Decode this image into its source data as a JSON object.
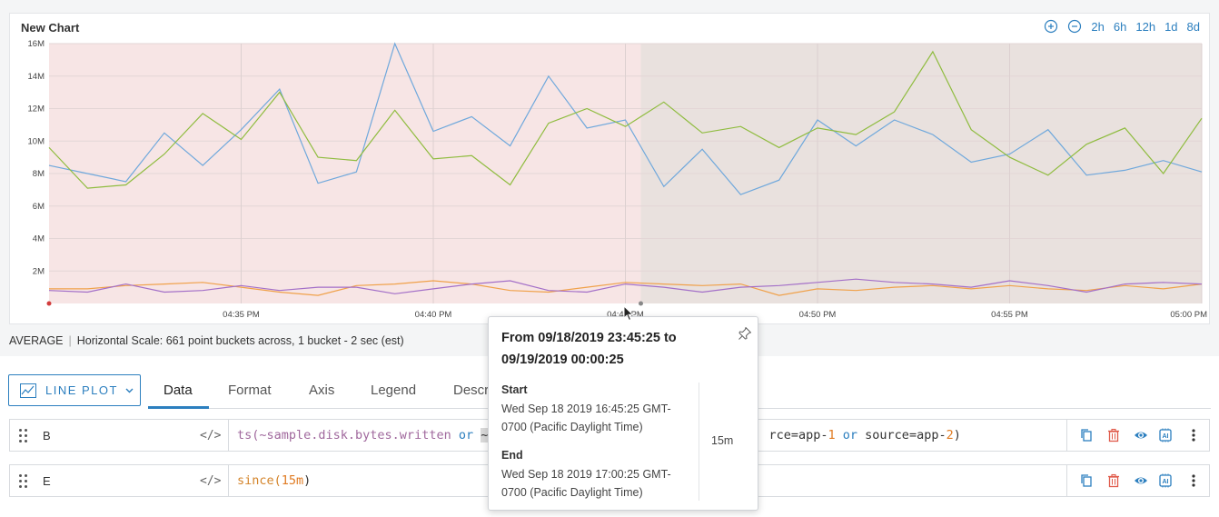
{
  "chart": {
    "title": "New Chart",
    "range_buttons": [
      "2h",
      "6h",
      "12h",
      "1d",
      "8d"
    ],
    "zoom_in_icon": "zoom-in-icon",
    "zoom_out_icon": "zoom-out-icon"
  },
  "chart_data": {
    "type": "line",
    "x_tick_labels": [
      "04:35 PM",
      "04:40 PM",
      "04:45 PM",
      "04:50 PM",
      "04:55 PM",
      "05:00 PM"
    ],
    "y_tick_labels": [
      "2M",
      "4M",
      "6M",
      "8M",
      "10M",
      "12M",
      "14M",
      "16M"
    ],
    "ylim": [
      0,
      16
    ],
    "grid": true,
    "highlight_band": {
      "from": "04:30 PM",
      "to": "05:00 PM",
      "color": "#f7e5e5"
    },
    "selected_band": {
      "from": "04:45 PM",
      "to": "05:00 PM",
      "color": "#e9e1de"
    },
    "series": [
      {
        "color": "#6fa8dc",
        "values": [
          8.5,
          8.0,
          7.5,
          10.5,
          8.5,
          10.7,
          13.2,
          7.4,
          8.1,
          16.0,
          10.6,
          11.5,
          9.7,
          14.0,
          10.8,
          11.3,
          7.2,
          9.5,
          6.7,
          7.6,
          11.3,
          9.7,
          11.3,
          10.4,
          8.7,
          9.2,
          10.7,
          7.9,
          8.2,
          8.8,
          8.1
        ]
      },
      {
        "color": "#8fbc3f",
        "values": [
          9.6,
          7.1,
          7.3,
          9.2,
          11.7,
          10.1,
          13.0,
          9.0,
          8.8,
          11.9,
          8.9,
          9.1,
          7.3,
          11.1,
          12.0,
          10.9,
          12.4,
          10.5,
          10.9,
          9.6,
          10.8,
          10.4,
          11.8,
          15.5,
          10.7,
          9.0,
          7.9,
          9.8,
          10.8,
          8.0,
          11.4
        ]
      },
      {
        "color": "#f0a14a",
        "values": [
          0.9,
          0.9,
          1.1,
          1.2,
          1.3,
          1.0,
          0.7,
          0.5,
          1.1,
          1.2,
          1.4,
          1.2,
          0.8,
          0.7,
          1.0,
          1.3,
          1.2,
          1.1,
          1.2,
          0.5,
          0.9,
          0.8,
          1.0,
          1.1,
          0.9,
          1.1,
          0.9,
          0.8,
          1.1,
          0.9,
          1.2
        ]
      },
      {
        "color": "#a36fc8",
        "values": [
          0.8,
          0.7,
          1.2,
          0.7,
          0.8,
          1.1,
          0.8,
          1.0,
          1.0,
          0.6,
          0.9,
          1.2,
          1.4,
          0.8,
          0.7,
          1.2,
          1.0,
          0.7,
          1.0,
          1.1,
          1.3,
          1.5,
          1.3,
          1.2,
          1.0,
          1.4,
          1.1,
          0.7,
          1.2,
          1.3,
          1.2
        ]
      }
    ]
  },
  "summary": {
    "mode": "AVERAGE",
    "separator": "|",
    "scale_text": "Horizontal Scale: 661 point buckets across, 1 bucket - 2 sec (est)"
  },
  "editor": {
    "plot_type": "LINE PLOT",
    "tabs": [
      "Data",
      "Format",
      "Axis",
      "Legend",
      "Descr"
    ],
    "active_tab": "Data",
    "code_toggle": "</>",
    "rows": [
      {
        "letter": "B",
        "q1": "ts(~sample.disk.bytes.written",
        "q2": " or ",
        "q3": "~s",
        "q4": "rce=app-",
        "q5": "1",
        "q6": " or ",
        "q7": "source=app-",
        "q8": "2",
        "q9": ")"
      },
      {
        "letter": "E",
        "q1": "since(",
        "q2": "15m",
        "q3": ")"
      }
    ]
  },
  "popup": {
    "title": "From 09/18/2019 23:45:25 to 09/19/2019 00:00:25",
    "start_label": "Start",
    "start_value": "Wed Sep 18 2019 16:45:25 GMT-0700 (Pacific Daylight Time)",
    "end_label": "End",
    "end_value": "Wed Sep 18 2019 17:00:25 GMT-0700 (Pacific Daylight Time)",
    "duration": "15m"
  }
}
